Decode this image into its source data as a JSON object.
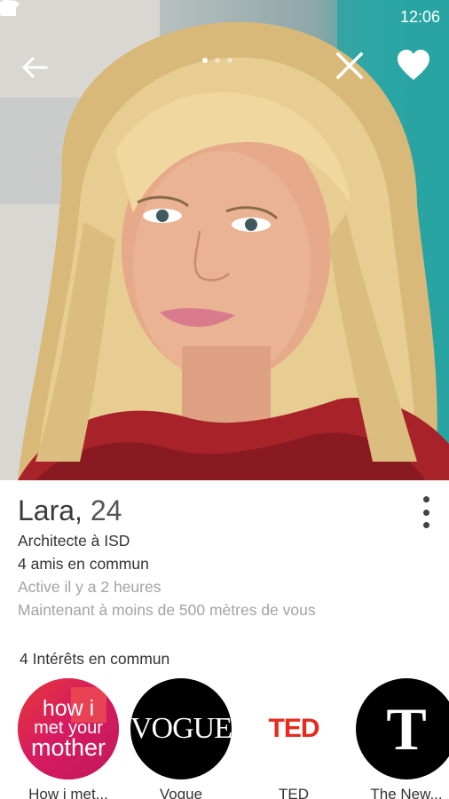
{
  "status_bar": {
    "time": "12:06"
  },
  "profile": {
    "name": "Lara,",
    "age": "24",
    "job": "Architecte à ISD",
    "mutual_friends": "4 amis en commun",
    "active": "Active il y a 2 heures",
    "distance": "Maintenant à moins de 500 mètres de vous"
  },
  "interests": {
    "title": "4 Intérêts en commun",
    "items": [
      {
        "label": "How i met...",
        "logo_lines": [
          "how i",
          "met your",
          "mother"
        ]
      },
      {
        "label": "Vogue",
        "logo": "VOGUE"
      },
      {
        "label": "TED",
        "logo": "TED"
      },
      {
        "label": "The New...",
        "logo": "T"
      }
    ]
  },
  "colors": {
    "ted_red": "#e62b1e",
    "himym_pink": "#d81b60"
  }
}
